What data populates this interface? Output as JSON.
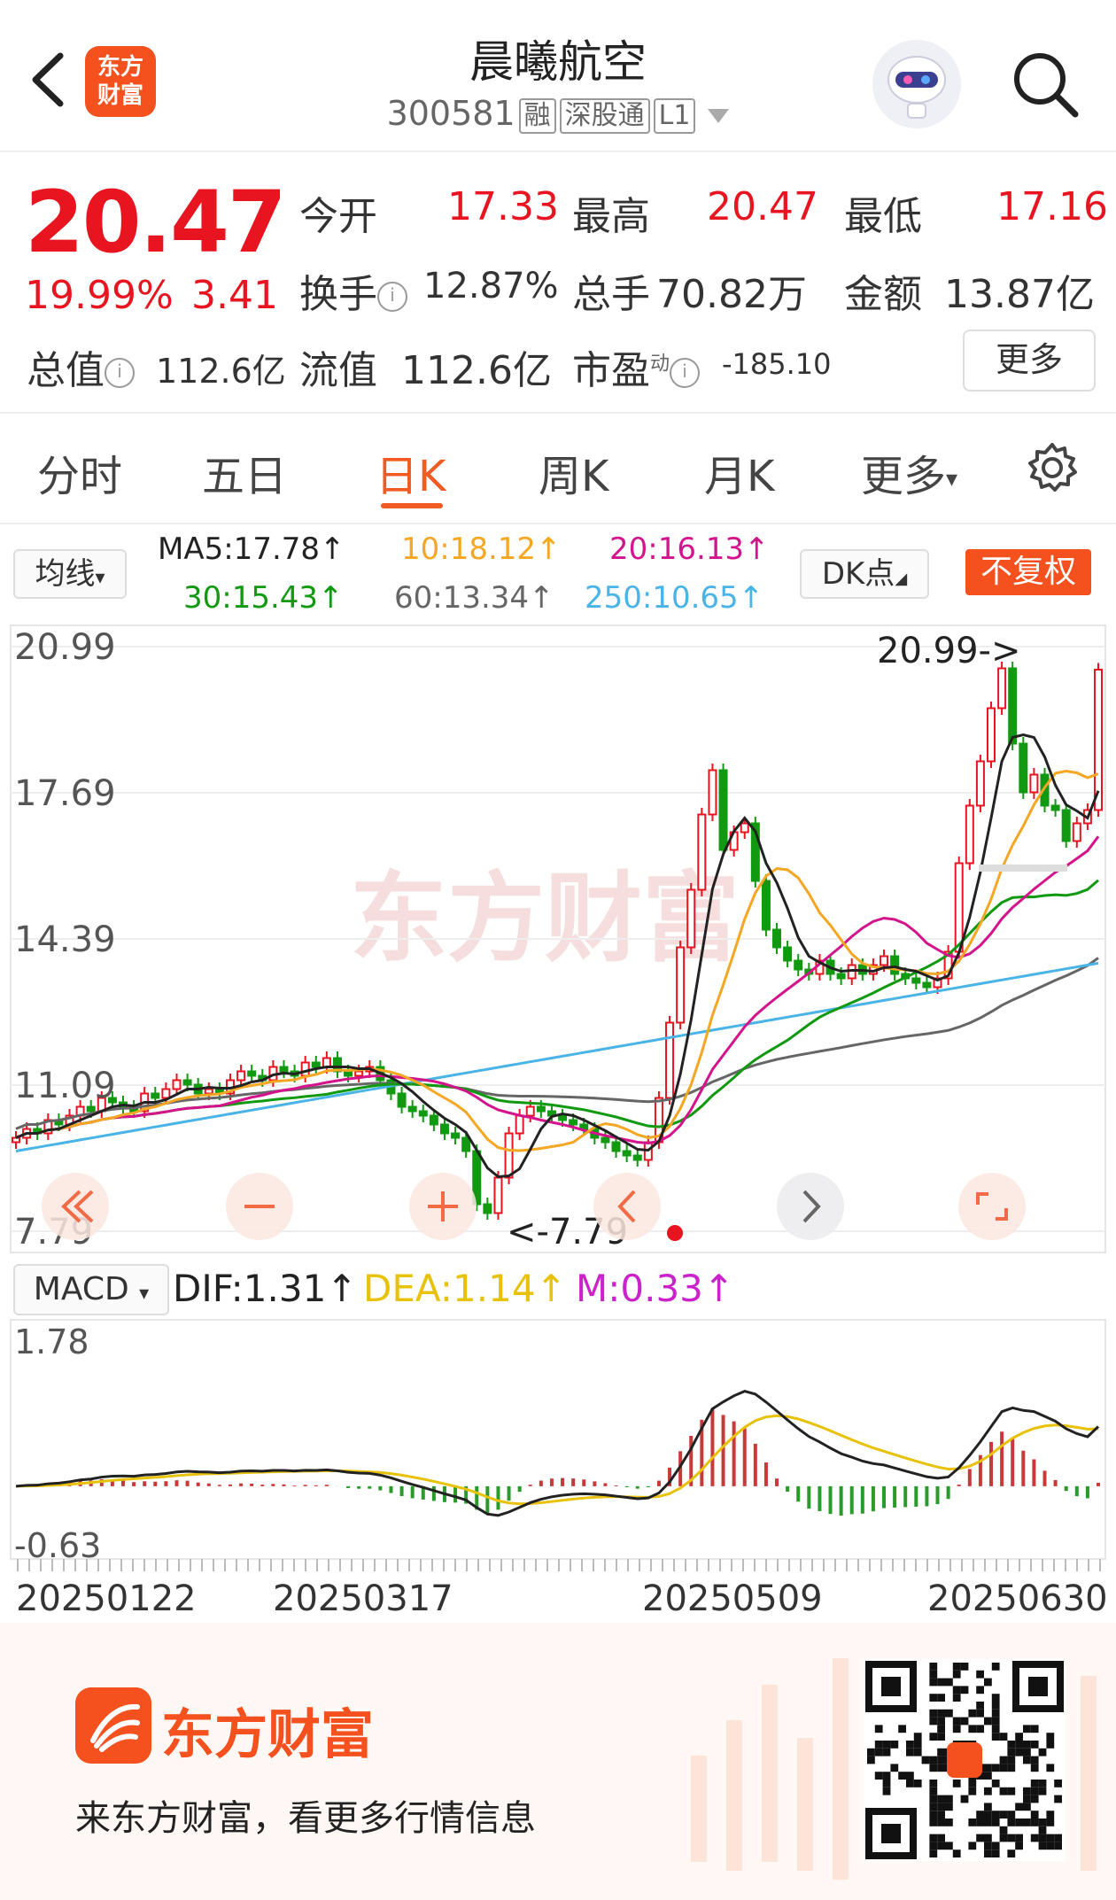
{
  "header": {
    "stock_name": "晨曦航空",
    "code": "300581",
    "tags": [
      "融",
      "深股通",
      "L1"
    ],
    "icons": [
      "back-arrow-icon",
      "eastmoney-logo",
      "robot-avatar-icon",
      "search-icon"
    ],
    "logo_line1": "东方",
    "logo_line2": "财富"
  },
  "quote": {
    "price": "20.47",
    "change_pct": "19.99%",
    "change": "3.41",
    "open_label": "今开",
    "open": "17.33",
    "high_label": "最高",
    "high": "20.47",
    "low_label": "最低",
    "low": "17.16",
    "turnover_label": "换手",
    "turnover": "12.87%",
    "volume_label": "总手",
    "volume": "70.82万",
    "amount_label": "金额",
    "amount": "13.87亿",
    "mktcap_label": "总值",
    "mktcap": "112.6亿",
    "float_label": "流值",
    "float": "112.6亿",
    "pe_label": "市盈",
    "pe_sup": "动",
    "pe": "-185.10",
    "more_label": "更多",
    "colors": {
      "up": "#e8141f",
      "accent": "#f15a22"
    }
  },
  "tabs": [
    "分时",
    "五日",
    "日K",
    "周K",
    "月K",
    "更多"
  ],
  "active_tab": "日K",
  "ma_bar": {
    "selector": "均线",
    "ma5": "MA5:17.78",
    "ma10": "10:18.12",
    "ma20": "20:16.13",
    "ma30": "30:15.43",
    "ma60": "60:13.34",
    "ma250": "250:10.65",
    "arrow": "↑",
    "dk_label": "DK点",
    "restore_label": "不复权",
    "colors": {
      "ma5": "#222222",
      "ma10": "#f5a623",
      "ma20": "#d4148c",
      "ma30": "#119911",
      "ma60": "#666666",
      "ma250": "#4ab4e6"
    }
  },
  "chart_data": [
    {
      "type": "candlestick",
      "title": "",
      "y_ticks": [
        "20.99",
        "17.69",
        "14.39",
        "11.09",
        "7.79"
      ],
      "ylim": [
        7.79,
        20.99
      ],
      "max_marker": "20.99->",
      "min_marker": "<-7.79",
      "watermark": "东方财富",
      "close_series": [
        9.9,
        10.1,
        10.0,
        10.3,
        10.2,
        10.4,
        10.6,
        10.5,
        10.8,
        10.7,
        10.6,
        10.5,
        10.9,
        10.8,
        11.0,
        11.2,
        11.1,
        10.9,
        11.0,
        10.9,
        11.2,
        11.4,
        11.3,
        11.2,
        11.5,
        11.4,
        11.3,
        11.6,
        11.5,
        11.7,
        11.4,
        11.3,
        11.4,
        11.5,
        11.2,
        10.9,
        10.6,
        10.5,
        10.4,
        10.2,
        10.0,
        9.9,
        9.6,
        8.4,
        8.2,
        9.0,
        10.0,
        10.4,
        10.6,
        10.5,
        10.4,
        10.3,
        10.2,
        10.1,
        9.9,
        9.8,
        9.6,
        9.5,
        9.4,
        9.8,
        10.8,
        12.5,
        14.2,
        15.5,
        17.2,
        18.2,
        16.4,
        16.8,
        17.0,
        15.7,
        14.6,
        14.2,
        13.9,
        13.7,
        13.6,
        13.9,
        13.6,
        13.5,
        13.8,
        13.6,
        13.8,
        14.0,
        13.6,
        13.5,
        13.4,
        13.3,
        13.5,
        14.1,
        16.1,
        17.4,
        18.4,
        19.6,
        20.5,
        18.8,
        17.7,
        18.1,
        17.4,
        17.3,
        16.6,
        17.0,
        17.3,
        20.47
      ],
      "ma_lines": [
        "MA5",
        "MA10",
        "MA20",
        "MA30",
        "MA60",
        "MA250"
      ]
    },
    {
      "type": "bar",
      "title": "",
      "indicator": "MACD",
      "dif": "DIF:1.31",
      "dea": "DEA:1.14",
      "m": "M:0.33",
      "y_ticks": [
        "1.78",
        "-0.63"
      ],
      "ylim": [
        -0.63,
        1.78
      ],
      "x_labels": [
        "20250122",
        "20250317",
        "20250509",
        "20250630"
      ],
      "colors": {
        "dif": "#222222",
        "dea": "#e8c20a",
        "m": "#cc22cc",
        "pos": "#c83a3a",
        "neg": "#2a9a2a"
      }
    }
  ],
  "nav_buttons": [
    "double-left-icon",
    "zoom-out-icon",
    "zoom-in-icon",
    "left-icon",
    "right-icon",
    "fullscreen-icon"
  ],
  "footer": {
    "brand": "东方财富",
    "slogan": "来东方财富，看更多行情信息"
  }
}
